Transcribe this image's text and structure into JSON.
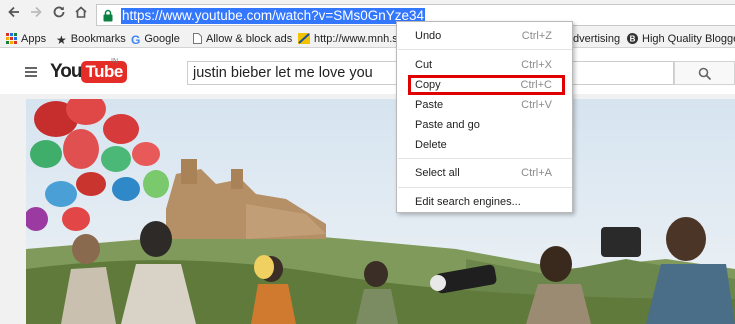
{
  "browser": {
    "url": "https://www.youtube.com/watch?v=SMs0GnYze34",
    "bookmarks": [
      {
        "label": "Apps",
        "icon": "apps-grid-icon"
      },
      {
        "label": "Bookmarks",
        "icon": "star-icon"
      },
      {
        "label": "Google",
        "icon": "google-icon"
      },
      {
        "label": "Allow & block ads",
        "icon": "page-icon"
      },
      {
        "label": "http://www.mnh.s",
        "icon": "site-favicon"
      },
      {
        "label": "dvertising",
        "icon": "none"
      },
      {
        "label": "High Quality Blogger",
        "icon": "blogger-icon"
      }
    ]
  },
  "youtube": {
    "logo_you": "You",
    "logo_tube": "Tube",
    "region": "IN",
    "search_query": "justin bieber let me love you"
  },
  "context_menu": {
    "items": [
      {
        "label": "Undo",
        "shortcut": "Ctrl+Z",
        "disabled": false
      },
      {
        "label": "Cut",
        "shortcut": "Ctrl+X",
        "disabled": false
      },
      {
        "label": "Copy",
        "shortcut": "Ctrl+C",
        "disabled": false,
        "highlighted": true
      },
      {
        "label": "Paste",
        "shortcut": "Ctrl+V",
        "disabled": false
      },
      {
        "label": "Paste and go",
        "shortcut": "",
        "disabled": false
      },
      {
        "label": "Delete",
        "shortcut": "",
        "disabled": false
      },
      {
        "label": "Select all",
        "shortcut": "Ctrl+A",
        "disabled": false
      },
      {
        "label": "Edit search engines...",
        "shortcut": "",
        "disabled": false
      }
    ]
  },
  "colors": {
    "url_selection": "#3377ff",
    "youtube_red": "#e52d27",
    "highlight_border": "#e00000"
  }
}
